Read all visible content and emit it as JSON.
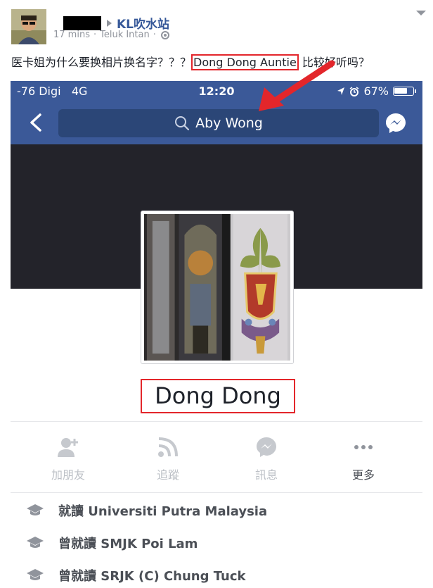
{
  "post": {
    "page_name": "KL吹水站",
    "time": "17 mins",
    "separator": "·",
    "location": "Teluk Intan",
    "text_before": "医卡姐为什么要换相片换名字？？？",
    "text_highlight": "Dong Dong Auntie",
    "text_after": " 比较好听吗？"
  },
  "screenshot": {
    "status": {
      "carrier": "-76 Digi",
      "network": "4G",
      "time": "12:20",
      "battery": "67%"
    },
    "search": {
      "query": "Aby Wong"
    },
    "profile": {
      "name": "Dong Dong"
    },
    "actions": [
      {
        "label": "加朋友",
        "icon": "add-friend-icon"
      },
      {
        "label": "追蹤",
        "icon": "follow-icon"
      },
      {
        "label": "訊息",
        "icon": "message-icon"
      },
      {
        "label": "更多",
        "icon": "more-icon"
      }
    ],
    "info": [
      {
        "prefix": "就讀",
        "school": "Universiti Putra Malaysia"
      },
      {
        "prefix": "曾就讀",
        "school": "SMJK Poi Lam"
      },
      {
        "prefix": "曾就讀",
        "school": "SRJK (C) Chung Tuck"
      }
    ]
  },
  "colors": {
    "facebook_blue": "#3b5998",
    "link_blue": "#365899",
    "highlight_red": "#e3262b",
    "arrow_red": "#e3262b"
  }
}
